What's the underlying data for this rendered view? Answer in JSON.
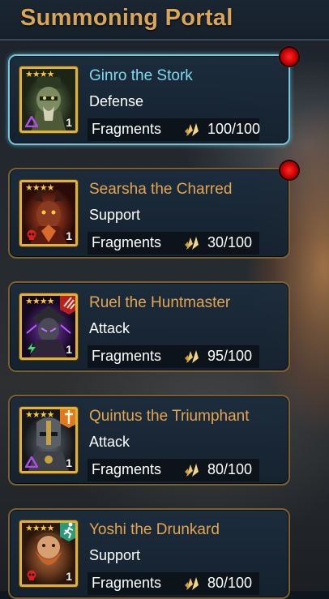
{
  "title": "Summoning Portal",
  "fragments_label": "Fragments",
  "cards": [
    {
      "name": "Ginro the Stork",
      "role": "Defense",
      "fragments": "100/100",
      "stars": "★★★★",
      "level": "1",
      "affinity": "magic",
      "faction": "none",
      "notification": true,
      "selected": true
    },
    {
      "name": "Searsha the Charred",
      "role": "Support",
      "fragments": "30/100",
      "stars": "★★★★",
      "level": "1",
      "affinity": "force",
      "faction": "none",
      "notification": true,
      "selected": false
    },
    {
      "name": "Ruel the Huntmaster",
      "role": "Attack",
      "fragments": "95/100",
      "stars": "★★★★",
      "level": "1",
      "affinity": "spirit",
      "faction": "banner-lords",
      "notification": false,
      "selected": false
    },
    {
      "name": "Quintus the Triumphant",
      "role": "Attack",
      "fragments": "80/100",
      "stars": "★★★★",
      "level": "1",
      "affinity": "magic",
      "faction": "sacred-order",
      "notification": false,
      "selected": false
    },
    {
      "name": "Yoshi the Drunkard",
      "role": "Support",
      "fragments": "80/100",
      "stars": "★★★★",
      "level": "1",
      "affinity": "force",
      "faction": "skinwalkers",
      "notification": false,
      "selected": false
    }
  ],
  "colors": {
    "title": "#d9a556",
    "name": "#e4a54e",
    "selected_name": "#7fd9ef",
    "selected_border": "#6fc8de",
    "card_border": "#7b6131",
    "portrait_frame": "#e2b235",
    "notification": "#e00000"
  },
  "icons": {
    "fragment": "fragment-shard-icon",
    "notification": "notification-dot-icon"
  }
}
